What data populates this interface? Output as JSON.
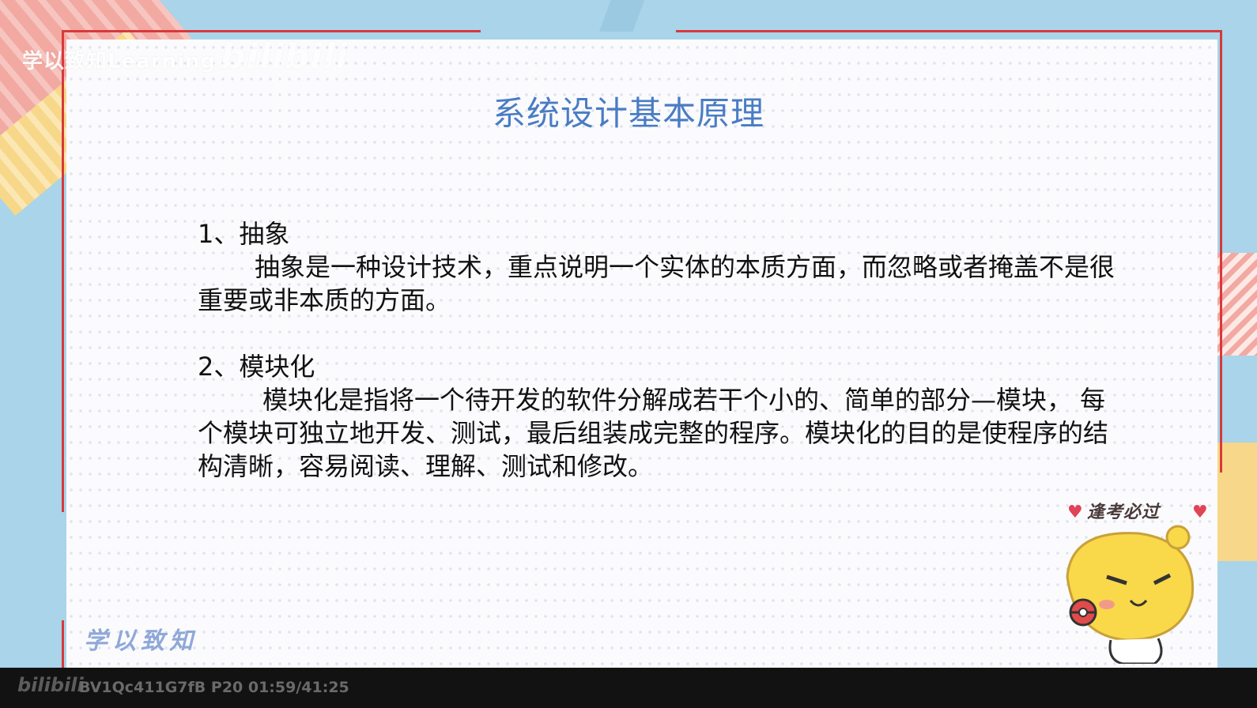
{
  "watermark": {
    "text": "学以致知Learning",
    "logo": "bilibili"
  },
  "slide": {
    "title": "系统设计基本原理",
    "sections": [
      {
        "heading": "1、抽象",
        "body": "抽象是一种设计技术，重点说明一个实体的本质方面，而忽略或者掩盖不是很重要或非本质的方面。"
      },
      {
        "heading": "2、模块化",
        "body": "模块化是指将一个待开发的软件分解成若干个小的、简单的部分—模块， 每个模块可独立地开发、测试，最后组装成完整的程序。模块化的目的是使程序的结构清晰，容易阅读、理解、测试和修改。"
      }
    ],
    "slogan": "逢考必过",
    "signature": "学以致知"
  },
  "player": {
    "logo": "bilibili",
    "info": "BV1Qc411G7fB P20 01:59/41:25"
  },
  "colors": {
    "title": "#4a7cc4",
    "frame": "#d8393b",
    "background": "#a9d4ea"
  }
}
